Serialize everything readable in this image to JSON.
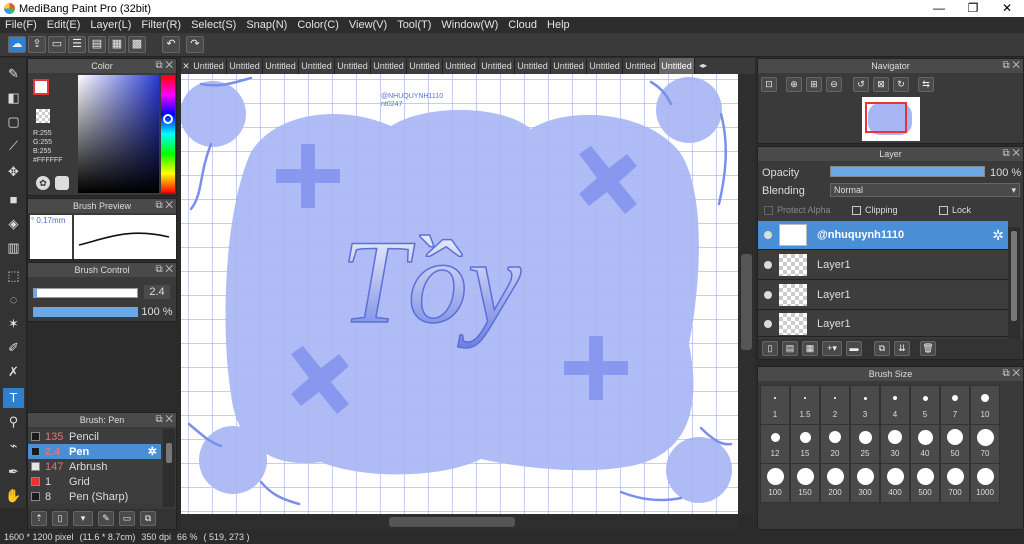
{
  "app": {
    "title": "MediBang Paint Pro (32bit)"
  },
  "window_controls": {
    "minimize": "—",
    "maximize": "❐",
    "close": "✕"
  },
  "menu": [
    "File(F)",
    "Edit(E)",
    "Layer(L)",
    "Filter(R)",
    "Select(S)",
    "Snap(N)",
    "Color(C)",
    "View(V)",
    "Tool(T)",
    "Window(W)",
    "Cloud",
    "Help"
  ],
  "color_panel": {
    "title": "Color",
    "r": "R:255",
    "g": "G:255",
    "b": "B:255",
    "hex": "#FFFFFF"
  },
  "brush_preview": {
    "title": "Brush Preview",
    "size": "0.17mm"
  },
  "brush_control": {
    "title": "Brush Control",
    "size_value": "2.4",
    "opacity_value": "100 %"
  },
  "brush_list": {
    "title": "Brush: Pen",
    "items": [
      {
        "size": "135",
        "name": "Pencil",
        "swatch": "#1a1a1a"
      },
      {
        "size": "2.4",
        "name": "Pen",
        "swatch": "#1a1a1a"
      },
      {
        "size": "147",
        "name": "Arbrush",
        "swatch": "#e5e5e5"
      },
      {
        "size": "1",
        "name": "Grid",
        "swatch": "#e53535"
      },
      {
        "size": "8",
        "name": "Pen (Sharp)",
        "swatch": "#1a1a1a"
      }
    ]
  },
  "canvas_tabs": [
    "Untitled",
    "Untitled",
    "Untitled",
    "Untitled",
    "Untitled",
    "Untitled",
    "Untitled",
    "Untitled",
    "Untitled",
    "Untitled",
    "Untitled",
    "Untitled",
    "Untitled",
    "Untitled",
    "Untitled"
  ],
  "canvas": {
    "watermark_line1": "@NHUQUYNH1110",
    "watermark_line2": "nt0247",
    "lettering": "Tồy",
    "accent": "#7b8fea",
    "blob": "#a9b6f5"
  },
  "navigator": {
    "title": "Navigator"
  },
  "layer_panel": {
    "title": "Layer",
    "opacity_label": "Opacity",
    "opacity_value": "100 %",
    "opacity_percent": 100,
    "blending_label": "Blending",
    "blending_value": "Normal",
    "protect_alpha": "Protect Alpha",
    "clipping": "Clipping",
    "lock": "Lock",
    "layers": [
      {
        "name": "@nhuquynh1110"
      },
      {
        "name": "Layer1"
      },
      {
        "name": "Layer1"
      },
      {
        "name": "Layer1"
      }
    ]
  },
  "brush_size": {
    "title": "Brush Size",
    "sizes": [
      "1",
      "1.5",
      "2",
      "3",
      "4",
      "5",
      "7",
      "10",
      "12",
      "15",
      "20",
      "25",
      "30",
      "40",
      "50",
      "70",
      "100",
      "150",
      "200",
      "300",
      "400",
      "500",
      "700",
      "1000"
    ]
  },
  "status": {
    "pixel": "1600 * 1200 pixel",
    "cm": "(11.6 * 8.7cm)",
    "dpi": "350 dpi",
    "zoom": "66 %",
    "coords": "( 519, 273 )"
  }
}
